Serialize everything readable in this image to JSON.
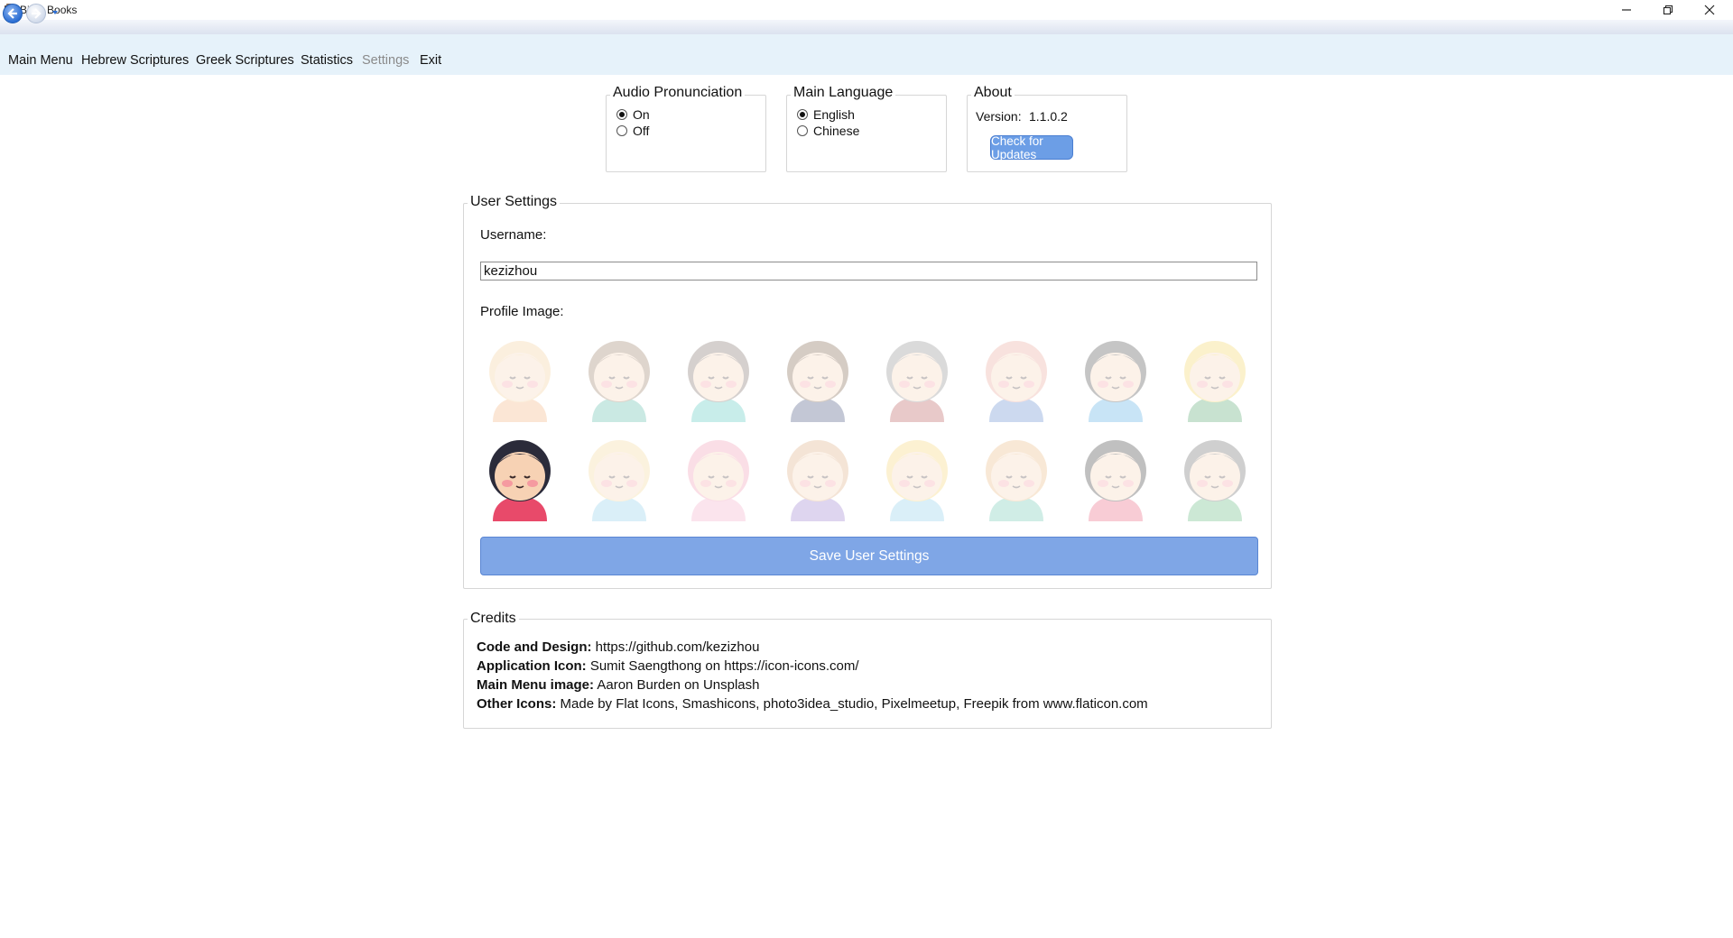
{
  "window": {
    "title": "Bible Books"
  },
  "menu": [
    {
      "label": "Main Menu",
      "disabled": false
    },
    {
      "label": "Hebrew Scriptures",
      "disabled": false
    },
    {
      "label": "Greek Scriptures",
      "disabled": false
    },
    {
      "label": "Statistics",
      "disabled": false
    },
    {
      "label": "Settings",
      "disabled": true
    },
    {
      "label": "Exit",
      "disabled": false
    }
  ],
  "audio": {
    "title": "Audio Pronunciation",
    "options": [
      {
        "label": "On",
        "checked": true
      },
      {
        "label": "Off",
        "checked": false
      }
    ]
  },
  "language": {
    "title": "Main Language",
    "options": [
      {
        "label": "English",
        "checked": true
      },
      {
        "label": "Chinese",
        "checked": false
      }
    ]
  },
  "about": {
    "title": "About",
    "version_label": "Version:",
    "version": "1.1.0.2",
    "update_button": "Check for Updates"
  },
  "user_settings": {
    "title": "User Settings",
    "username_label": "Username:",
    "username_value": "kezizhou",
    "profile_label": "Profile Image:",
    "save_button": "Save User Settings",
    "avatars": [
      {
        "icon": "avatar-boy-cap-icon",
        "hair": "#f3c98a",
        "shirt": "#f2a86a",
        "selected": false
      },
      {
        "icon": "avatar-boy-curly-icon",
        "hair": "#8b6a4e",
        "shirt": "#45b39d",
        "selected": false
      },
      {
        "icon": "avatar-boy-headband-icon",
        "hair": "#6b5a52",
        "shirt": "#3cc0b5",
        "selected": false
      },
      {
        "icon": "avatar-boy-brown-icon",
        "hair": "#6b4a30",
        "shirt": "#2b3a6b",
        "selected": false
      },
      {
        "icon": "avatar-boy-grey-icon",
        "hair": "#7d7d7d",
        "shirt": "#b04040",
        "selected": false
      },
      {
        "icon": "avatar-boy-pink-icon",
        "hair": "#e79a8a",
        "shirt": "#4a78c8",
        "selected": false
      },
      {
        "icon": "avatar-man-black-icon",
        "hair": "#333333",
        "shirt": "#3da0e0",
        "selected": false
      },
      {
        "icon": "avatar-man-blond-icon",
        "hair": "#f3cf4a",
        "shirt": "#3c9a5a",
        "selected": false
      },
      {
        "icon": "avatar-girl-headscarf-icon",
        "hair": "#2b2b3a",
        "shirt": "#e84a6a",
        "selected": true
      },
      {
        "icon": "avatar-girl-blonde-icon",
        "hair": "#f4d48a",
        "shirt": "#7ec8e8",
        "selected": false
      },
      {
        "icon": "avatar-girl-pink-buns-icon",
        "hair": "#f08aa8",
        "shirt": "#f3a0c0",
        "selected": false
      },
      {
        "icon": "avatar-girl-long-icon",
        "hair": "#d8a070",
        "shirt": "#8a6ac8",
        "selected": false
      },
      {
        "icon": "avatar-girl-pigtails-icon",
        "hair": "#f6d060",
        "shirt": "#7ec8e8",
        "selected": false
      },
      {
        "icon": "avatar-girl-flowers-icon",
        "hair": "#e8b070",
        "shirt": "#5ac0a8",
        "selected": false
      },
      {
        "icon": "avatar-girl-black-flower-icon",
        "hair": "#222222",
        "shirt": "#e84a6a",
        "selected": false
      },
      {
        "icon": "avatar-girl-grey-icon",
        "hair": "#555555",
        "shirt": "#4ab06a",
        "selected": false
      }
    ]
  },
  "credits": {
    "title": "Credits",
    "lines": [
      {
        "key": "Code and Design:",
        "value": " https://github.com/kezizhou"
      },
      {
        "key": "Application Icon:",
        "value": " Sumit Saengthong on https://icon-icons.com/"
      },
      {
        "key": "Main Menu image:",
        "value": " Aaron Burden on Unsplash"
      },
      {
        "key": "Other Icons:",
        "value": " Made by Flat Icons, Smashicons, photo3idea_studio, Pixelmeetup, Freepik from www.flaticon.com"
      }
    ]
  }
}
